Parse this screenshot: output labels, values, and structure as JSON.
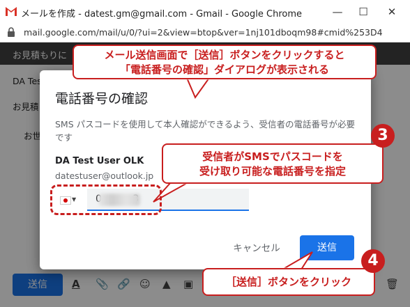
{
  "window": {
    "title": "メールを作成 - datest.gm@gmail.com - Gmail - Google Chrome",
    "url": "mail.google.com/mail/u/0/?ui=2&view=btop&ver=1nj101dboqm98#cmid%253D4",
    "minimize": "—",
    "maximize": "☐",
    "close": "✕"
  },
  "compose": {
    "header": "お見積もりに",
    "to_field": "DA Tes",
    "subject_field": "お見積",
    "body_start": "お世",
    "send_label": "送信",
    "tools": [
      "A",
      "📎",
      "🔗",
      "☺",
      "▲",
      "▣"
    ]
  },
  "dialog": {
    "title": "電話番号の確認",
    "description": "SMS パスコードを使用して本人確認ができるよう、受信者の電話番号が必要です",
    "recipient_name": "DA Test User OLK",
    "recipient_email": "datestuser@outlook.jp",
    "phone_value": "0          3",
    "cancel_label": "キャンセル",
    "send_label": "送信"
  },
  "annotations": {
    "callout1_line1": "メール送信画面で［送信］ボタンをクリックすると",
    "callout1_line2": "「電話番号の確認」ダイアログが表示される",
    "callout2_line1": "受信者がSMSでパスコードを",
    "callout2_line2": "受け取り可能な電話番号を指定",
    "callout3": "［送信］ボタンをクリック",
    "step3": "3",
    "step4": "4"
  },
  "colors": {
    "accent": "#1a73e8",
    "annotation_red": "#c81e1e"
  }
}
